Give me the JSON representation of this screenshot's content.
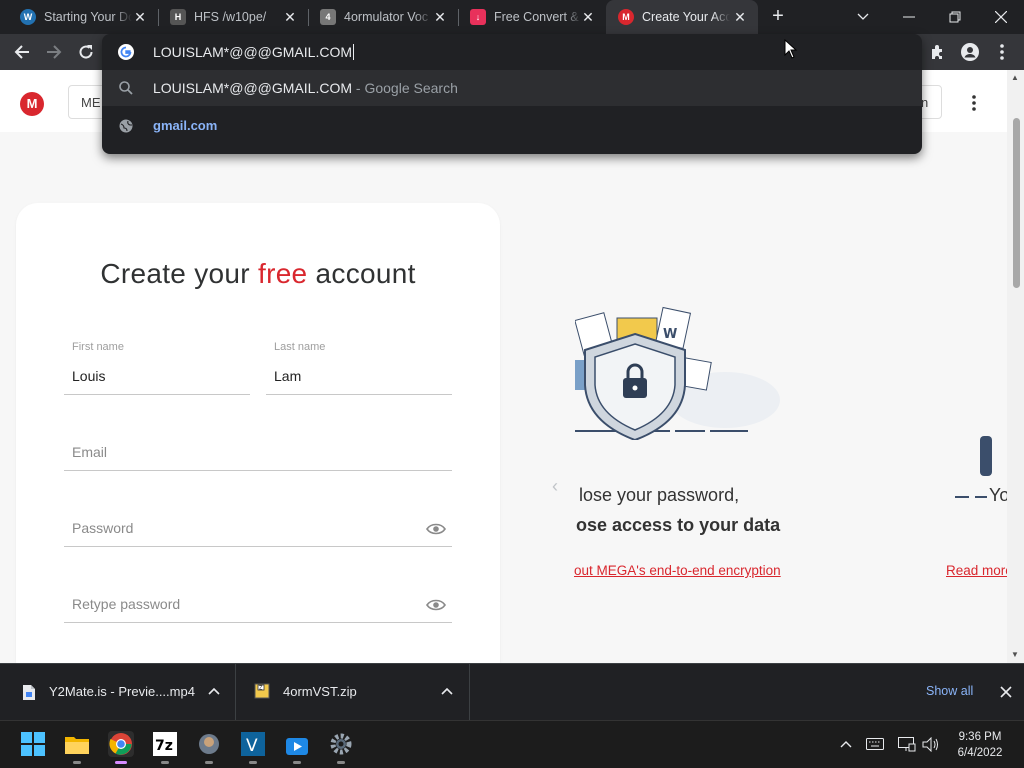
{
  "browser": {
    "tabs": [
      {
        "title": "Starting Your Do",
        "favicon": "wordpress-icon",
        "color": "#2271b1"
      },
      {
        "title": "HFS /w10pe/",
        "favicon": "hfs-icon",
        "color": "#555555"
      },
      {
        "title": "4ormulator Voc",
        "favicon": "4ormulator-icon",
        "color": "#777777"
      },
      {
        "title": "Free Convert &",
        "favicon": "download-icon",
        "color": "#e8315b"
      },
      {
        "title": "Create Your Acc",
        "favicon": "mega-icon",
        "color": "#d9272e",
        "active": true
      }
    ],
    "new_tab_label": "+",
    "omnibox": {
      "input": "LOUISLAM*@@@GMAIL.COM",
      "suggestions": [
        {
          "text": "LOUISLAM*@@@GMAIL.COM",
          "desc": " - Google Search",
          "icon": "search-icon"
        },
        {
          "text": "gmail.com",
          "icon": "globe-icon"
        }
      ]
    }
  },
  "page": {
    "header_search_partial": "ME",
    "header_btn_partial": "n",
    "title_part1": "Create your ",
    "title_free": "free",
    "title_part2": " account",
    "first_name": {
      "label": "First name",
      "value": "Louis"
    },
    "last_name": {
      "label": "Last name",
      "value": "Lam"
    },
    "email": {
      "placeholder": "Email"
    },
    "password": {
      "placeholder": "Password"
    },
    "retype_password": {
      "placeholder": "Retype password"
    },
    "carousel": {
      "line1": "lose your password,",
      "line2": "ose access to your data",
      "link": "out MEGA's end-to-end encryption",
      "next_partial": "Yo",
      "next_link_partial": "Read more"
    }
  },
  "downloads": [
    {
      "name": "Y2Mate.is - Previe....mp4",
      "icon": "file-icon"
    },
    {
      "name": "4ormVST.zip",
      "icon": "zip-icon"
    }
  ],
  "downloads_show_all": "Show all",
  "taskbar": {
    "time": "9:36 PM",
    "date": "6/4/2022",
    "apps": [
      "start-icon",
      "file-explorer-icon",
      "chrome-icon",
      "7zip-icon",
      "app-icon",
      "visual-studio-icon",
      "video-icon",
      "settings-icon"
    ]
  }
}
